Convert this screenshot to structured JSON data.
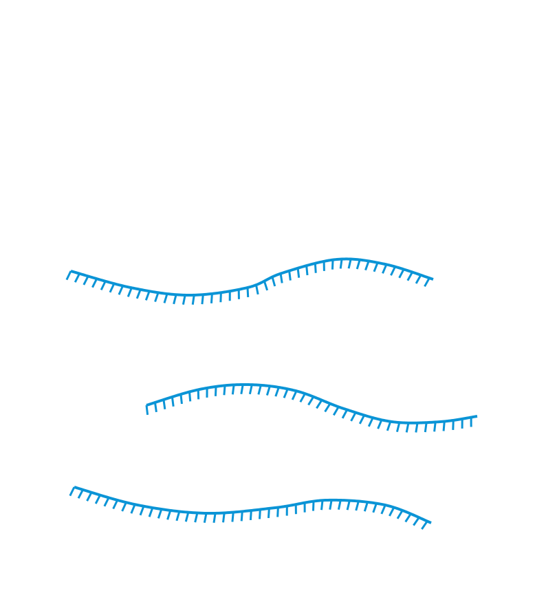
{
  "drawing": {
    "stroke_color": "#0b94d6",
    "background": "#ffffff",
    "shapes": [
      {
        "name": "hatched-wave-curve-top"
      },
      {
        "name": "hatched-wave-curve-middle"
      },
      {
        "name": "hatched-wave-curve-bottom"
      }
    ]
  }
}
